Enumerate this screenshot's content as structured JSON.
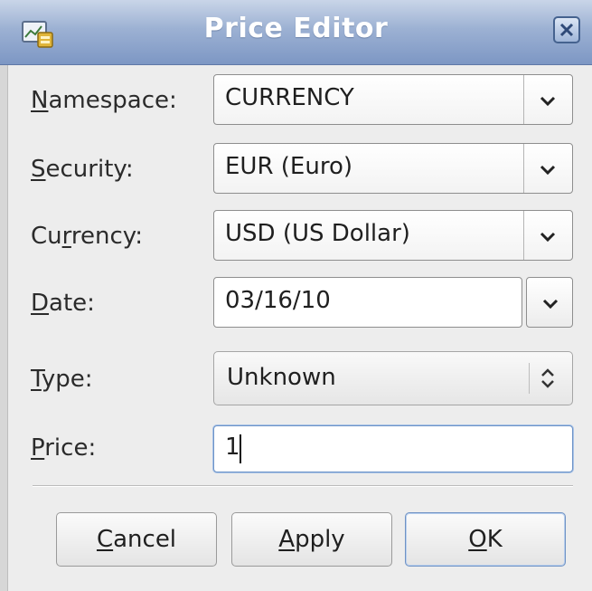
{
  "window": {
    "title": "Price Editor",
    "app_icon": "price-editor-app-icon",
    "close_icon": "close-icon"
  },
  "fields": {
    "namespace": {
      "label_mnemonic": "N",
      "label_rest": "amespace:",
      "value": "CURRENCY"
    },
    "security": {
      "label_mnemonic": "S",
      "label_rest": "ecurity:",
      "value": "EUR (Euro)"
    },
    "currency": {
      "label_pre": "Cu",
      "label_mnemonic": "r",
      "label_rest": "rency:",
      "value": "USD (US Dollar)"
    },
    "date": {
      "label_mnemonic": "D",
      "label_rest": "ate:",
      "value": "03/16/10"
    },
    "type": {
      "label_mnemonic": "T",
      "label_rest": "ype:",
      "value": "Unknown"
    },
    "price": {
      "label_mnemonic": "P",
      "label_rest": "rice:",
      "value": "1"
    }
  },
  "buttons": {
    "cancel": {
      "mnemonic": "C",
      "rest": "ancel"
    },
    "apply": {
      "mnemonic": "A",
      "rest": "pply"
    },
    "ok": {
      "mnemonic": "O",
      "rest": "K"
    }
  },
  "colors": {
    "titlebar_top": "#c9d5e8",
    "titlebar_bottom": "#7d97c4",
    "dialog_bg": "#ededed",
    "focus_border": "#6e94c8"
  }
}
